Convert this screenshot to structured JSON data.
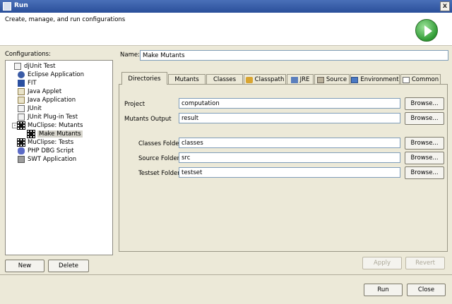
{
  "window": {
    "title": "Run",
    "close_label": "x"
  },
  "header": {
    "subtitle": "Create, manage, and run configurations"
  },
  "sidebar": {
    "label": "Configurations:",
    "items": [
      {
        "label": "djUnit Test"
      },
      {
        "label": "Eclipse Application"
      },
      {
        "label": "FIT"
      },
      {
        "label": "Java Applet"
      },
      {
        "label": "Java Application"
      },
      {
        "label": "JUnit"
      },
      {
        "label": "JUnit Plug-in Test"
      },
      {
        "label": "MuClipse: Mutants"
      },
      {
        "label": "Make Mutants"
      },
      {
        "label": "MuClipse: Tests"
      },
      {
        "label": "PHP DBG Script"
      },
      {
        "label": "SWT Application"
      }
    ],
    "new_label": "New",
    "delete_label": "Delete"
  },
  "name": {
    "label": "Name:",
    "value": "Make Mutants"
  },
  "tabs": [
    {
      "label": "Directories"
    },
    {
      "label": "Mutants"
    },
    {
      "label": "Classes"
    },
    {
      "label": "Classpath"
    },
    {
      "label": "JRE"
    },
    {
      "label": "Source"
    },
    {
      "label": "Environment"
    },
    {
      "label": "Common"
    }
  ],
  "form": {
    "project_label": "Project",
    "project_value": "computation",
    "mutants_output_label": "Mutants Output",
    "mutants_output_value": "result",
    "classes_folder_label": "Classes Folder",
    "classes_folder_value": "classes",
    "source_folder_label": "Source Folder",
    "source_folder_value": "src",
    "testset_folder_label": "Testset Folder",
    "testset_folder_value": "testset",
    "browse_label": "Browse..."
  },
  "actions": {
    "apply_label": "Apply",
    "revert_label": "Revert"
  },
  "footer": {
    "run_label": "Run",
    "close_label": "Close"
  }
}
